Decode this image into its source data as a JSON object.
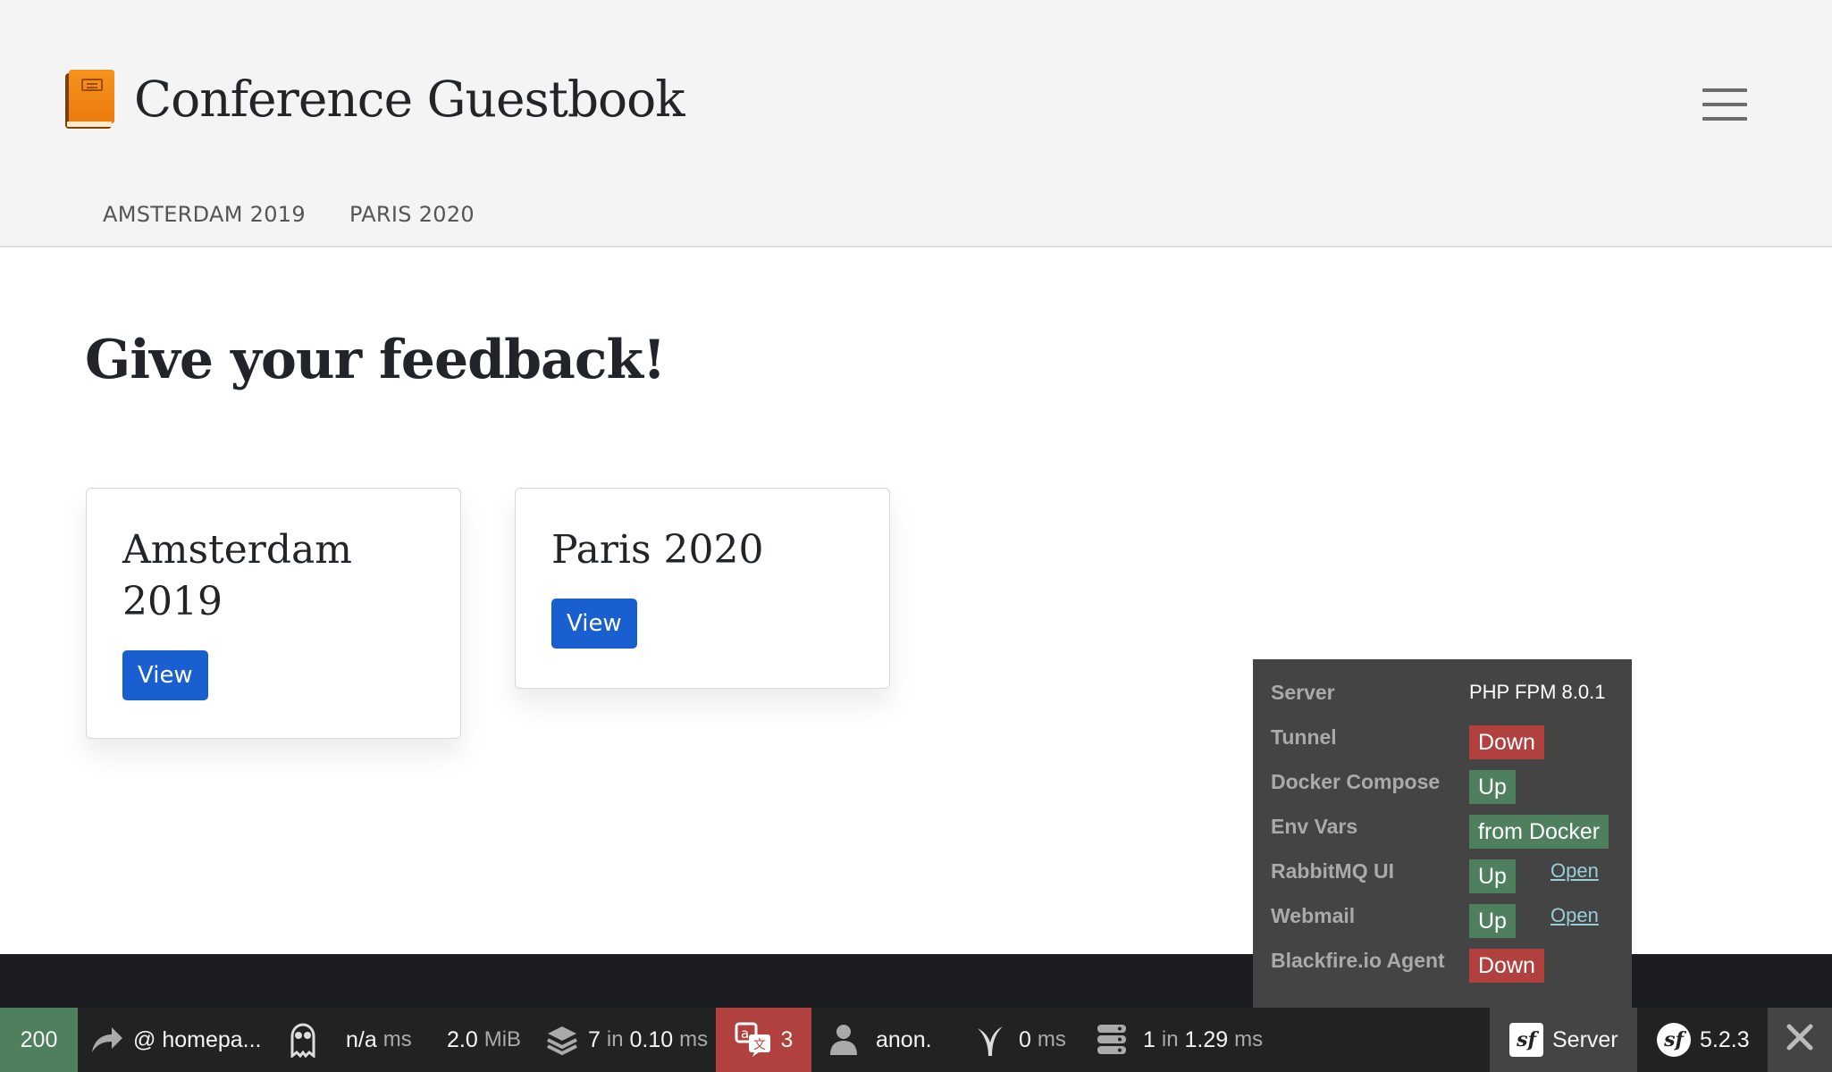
{
  "header": {
    "brand_icon": "ledger-book-icon",
    "title": "Conference Guestbook",
    "menu_icon": "hamburger-menu-icon",
    "nav": [
      "AMSTERDAM 2019",
      "PARIS 2020"
    ]
  },
  "main": {
    "title": "Give your feedback!",
    "cards": [
      {
        "title": "Amsterdam 2019",
        "button": "View"
      },
      {
        "title": "Paris 2020",
        "button": "View"
      }
    ]
  },
  "server_panel": {
    "server": {
      "label": "Server",
      "value": "PHP FPM 8.0.1"
    },
    "rows": [
      {
        "label": "Tunnel",
        "status": "Down",
        "color": "#b0413e"
      },
      {
        "label": "Docker Compose",
        "status": "Up",
        "color": "#4f805d"
      },
      {
        "label": "Env Vars",
        "status": "from Docker",
        "color": "#4f805d"
      },
      {
        "label": "RabbitMQ UI",
        "status": "Up",
        "link": "Open",
        "color": "#4f805d"
      },
      {
        "label": "Webmail",
        "status": "Up",
        "link": "Open",
        "color": "#4f805d"
      },
      {
        "label": "Blackfire.io Agent",
        "status": "Down",
        "color": "#b0413e"
      }
    ]
  },
  "toolbar": {
    "status_code": "200",
    "route": "@ homepa...",
    "time_value": "n/a",
    "time_unit": "ms",
    "memory_value": "2.0",
    "memory_unit": "MiB",
    "twig_count": "7",
    "twig_in": "in",
    "twig_time": "0.10",
    "twig_unit": "ms",
    "translation_count": "3",
    "user": "anon.",
    "cache_value": "0",
    "cache_unit": "ms",
    "db_count": "1",
    "db_in": "in",
    "db_time": "1.29",
    "db_unit": "ms",
    "server_label": "Server",
    "sf_version": "5.2.3",
    "colors": {
      "success": "#4f805d",
      "error": "#b0413e",
      "bg": "#222222"
    }
  }
}
